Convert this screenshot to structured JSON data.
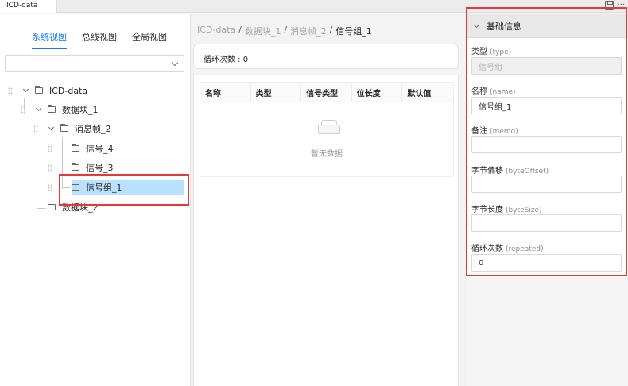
{
  "window": {
    "tab_title": "ICD-data"
  },
  "left_panel": {
    "tabs": [
      {
        "label": "系统视图",
        "active": true
      },
      {
        "label": "总线视图",
        "active": false
      },
      {
        "label": "全局视图",
        "active": false
      }
    ],
    "select_value": "",
    "tree": [
      {
        "label": "ICD-data",
        "expanded": true
      },
      {
        "label": "数据块_1",
        "expanded": true
      },
      {
        "label": "消息帧_2",
        "expanded": true
      },
      {
        "label": "信号_4"
      },
      {
        "label": "信号_3"
      },
      {
        "label": "信号组_1",
        "selected": true
      },
      {
        "label": "数据块_2"
      }
    ]
  },
  "breadcrumb": [
    "ICD-data",
    "数据块_1",
    "消息帧_2",
    "信号组_1"
  ],
  "loop_info": "循环次数 : 0",
  "table": {
    "columns": [
      "名称",
      "类型",
      "信号类型",
      "位长度",
      "默认值"
    ],
    "empty_text": "暂无数据"
  },
  "properties": {
    "section_title": "基础信息",
    "fields": [
      {
        "label": "类型",
        "hint": "(type)",
        "value": "信号组",
        "disabled": true
      },
      {
        "label": "名称",
        "hint": "(name)",
        "value": "信号组_1"
      },
      {
        "label": "备注",
        "hint": "(memo)",
        "value": ""
      },
      {
        "label": "字节偏移",
        "hint": "(byteOffset)",
        "value": ""
      },
      {
        "label": "字节长度",
        "hint": "(byteSize)",
        "value": ""
      },
      {
        "label": "循环次数",
        "hint": "(repeated)",
        "value": "0"
      }
    ]
  },
  "colors": {
    "accent": "#1677ff",
    "selection": "#bae0ff",
    "annotation": "#e53935"
  }
}
